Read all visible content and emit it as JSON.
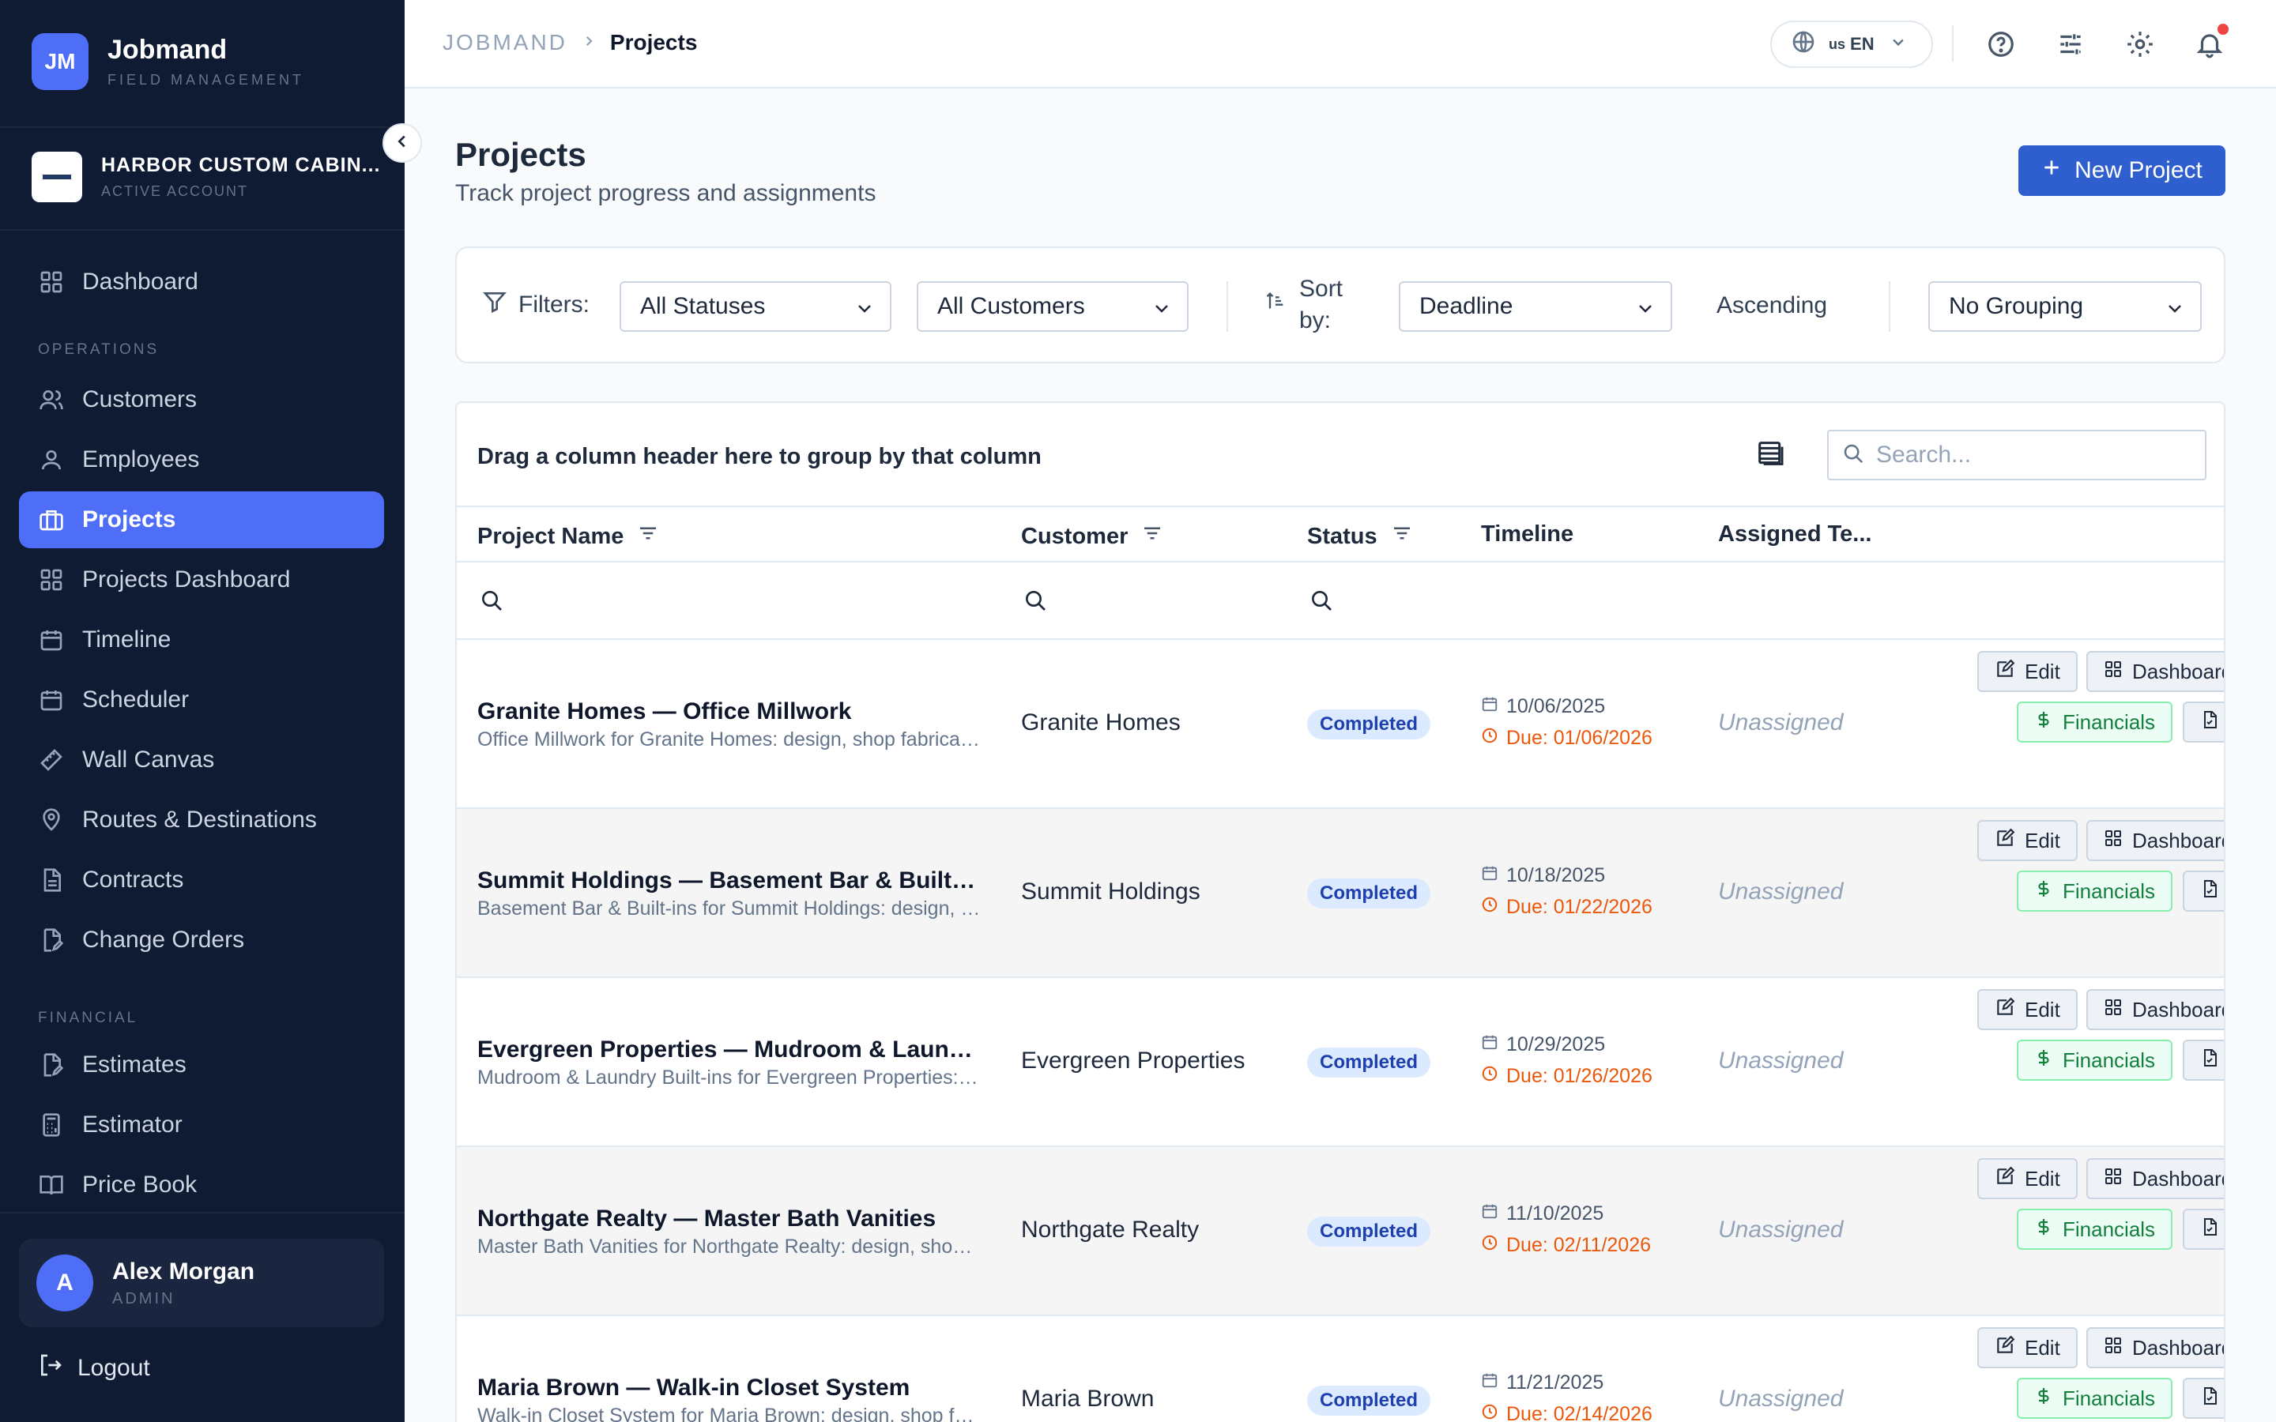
{
  "brand": {
    "initials": "JM",
    "name": "Jobmand",
    "subtitle": "FIELD MANAGEMENT"
  },
  "account": {
    "name": "HARBOR CUSTOM CABIN...",
    "status": "ACTIVE ACCOUNT"
  },
  "nav": {
    "top": [
      {
        "label": "Dashboard",
        "icon": "grid-icon"
      }
    ],
    "operations_label": "OPERATIONS",
    "operations": [
      {
        "label": "Customers",
        "icon": "users-icon"
      },
      {
        "label": "Employees",
        "icon": "user-icon"
      },
      {
        "label": "Projects",
        "icon": "briefcase-icon",
        "active": true
      },
      {
        "label": "Projects Dashboard",
        "icon": "grid-icon"
      },
      {
        "label": "Timeline",
        "icon": "calendar-icon"
      },
      {
        "label": "Scheduler",
        "icon": "calendar-icon"
      },
      {
        "label": "Wall Canvas",
        "icon": "ruler-icon"
      },
      {
        "label": "Routes & Destinations",
        "icon": "map-pin-icon"
      },
      {
        "label": "Contracts",
        "icon": "file-icon"
      },
      {
        "label": "Change Orders",
        "icon": "file-edit-icon"
      }
    ],
    "financial_label": "FINANCIAL",
    "financial": [
      {
        "label": "Estimates",
        "icon": "file-edit-icon"
      },
      {
        "label": "Estimator",
        "icon": "calculator-icon"
      },
      {
        "label": "Price Book",
        "icon": "book-icon"
      }
    ]
  },
  "user": {
    "initial": "A",
    "name": "Alex Morgan",
    "role": "ADMIN"
  },
  "logout_label": "Logout",
  "header": {
    "breadcrumb_root": "JOBMAND",
    "breadcrumb_current": "Projects",
    "lang_flag": "us",
    "lang_code": "EN"
  },
  "page": {
    "title": "Projects",
    "subtitle": "Track project progress and assignments",
    "new_button": "New Project"
  },
  "filters": {
    "label": "Filters:",
    "status": "All Statuses",
    "customer": "All Customers",
    "sort_label": "Sort by:",
    "sort_field": "Deadline",
    "sort_order": "Ascending",
    "grouping": "No Grouping"
  },
  "grid": {
    "group_hint": "Drag a column header here to group by that column",
    "search_placeholder": "Search...",
    "columns": [
      "Project Name",
      "Customer",
      "Status",
      "Timeline",
      "Assigned Te..."
    ],
    "actions": {
      "edit": "Edit",
      "dashboard": "Dashboard",
      "financials": "Financials"
    },
    "rows": [
      {
        "name": "Granite Homes — Office Millwork",
        "desc": "Office Millwork for Granite Homes: design, shop fabrication, delivery and installation.",
        "customer": "Granite Homes",
        "status": "Completed",
        "start": "10/06/2025",
        "due": "Due: 01/06/2026",
        "assigned": "Unassigned"
      },
      {
        "name": "Summit Holdings — Basement Bar & Built-ins",
        "desc": "Basement Bar & Built-ins for Summit Holdings: design, shop fabrication, delivery and installation.",
        "customer": "Summit Holdings",
        "status": "Completed",
        "start": "10/18/2025",
        "due": "Due: 01/22/2026",
        "assigned": "Unassigned"
      },
      {
        "name": "Evergreen Properties — Mudroom & Laundry Built-ins",
        "desc": "Mudroom & Laundry Built-ins for Evergreen Properties: design, shop fabrication, delivery and installation.",
        "customer": "Evergreen Properties",
        "status": "Completed",
        "start": "10/29/2025",
        "due": "Due: 01/26/2026",
        "assigned": "Unassigned"
      },
      {
        "name": "Northgate Realty — Master Bath Vanities",
        "desc": "Master Bath Vanities for Northgate Realty: design, shop fabrication, delivery and installation.",
        "customer": "Northgate Realty",
        "status": "Completed",
        "start": "11/10/2025",
        "due": "Due: 02/11/2026",
        "assigned": "Unassigned"
      },
      {
        "name": "Maria Brown — Walk-in Closet System",
        "desc": "Walk-in Closet System for Maria Brown: design, shop fabrication, delivery and installation.",
        "customer": "Maria Brown",
        "status": "Completed",
        "start": "11/21/2025",
        "due": "Due: 02/14/2026",
        "assigned": "Unassigned"
      }
    ]
  },
  "colors": {
    "sidebar_bg": "#0f1a33",
    "accent": "#4f6ef7",
    "primary_button": "#2f5fcf",
    "due_text": "#ea580c",
    "status_badge": "#dbeafe"
  }
}
